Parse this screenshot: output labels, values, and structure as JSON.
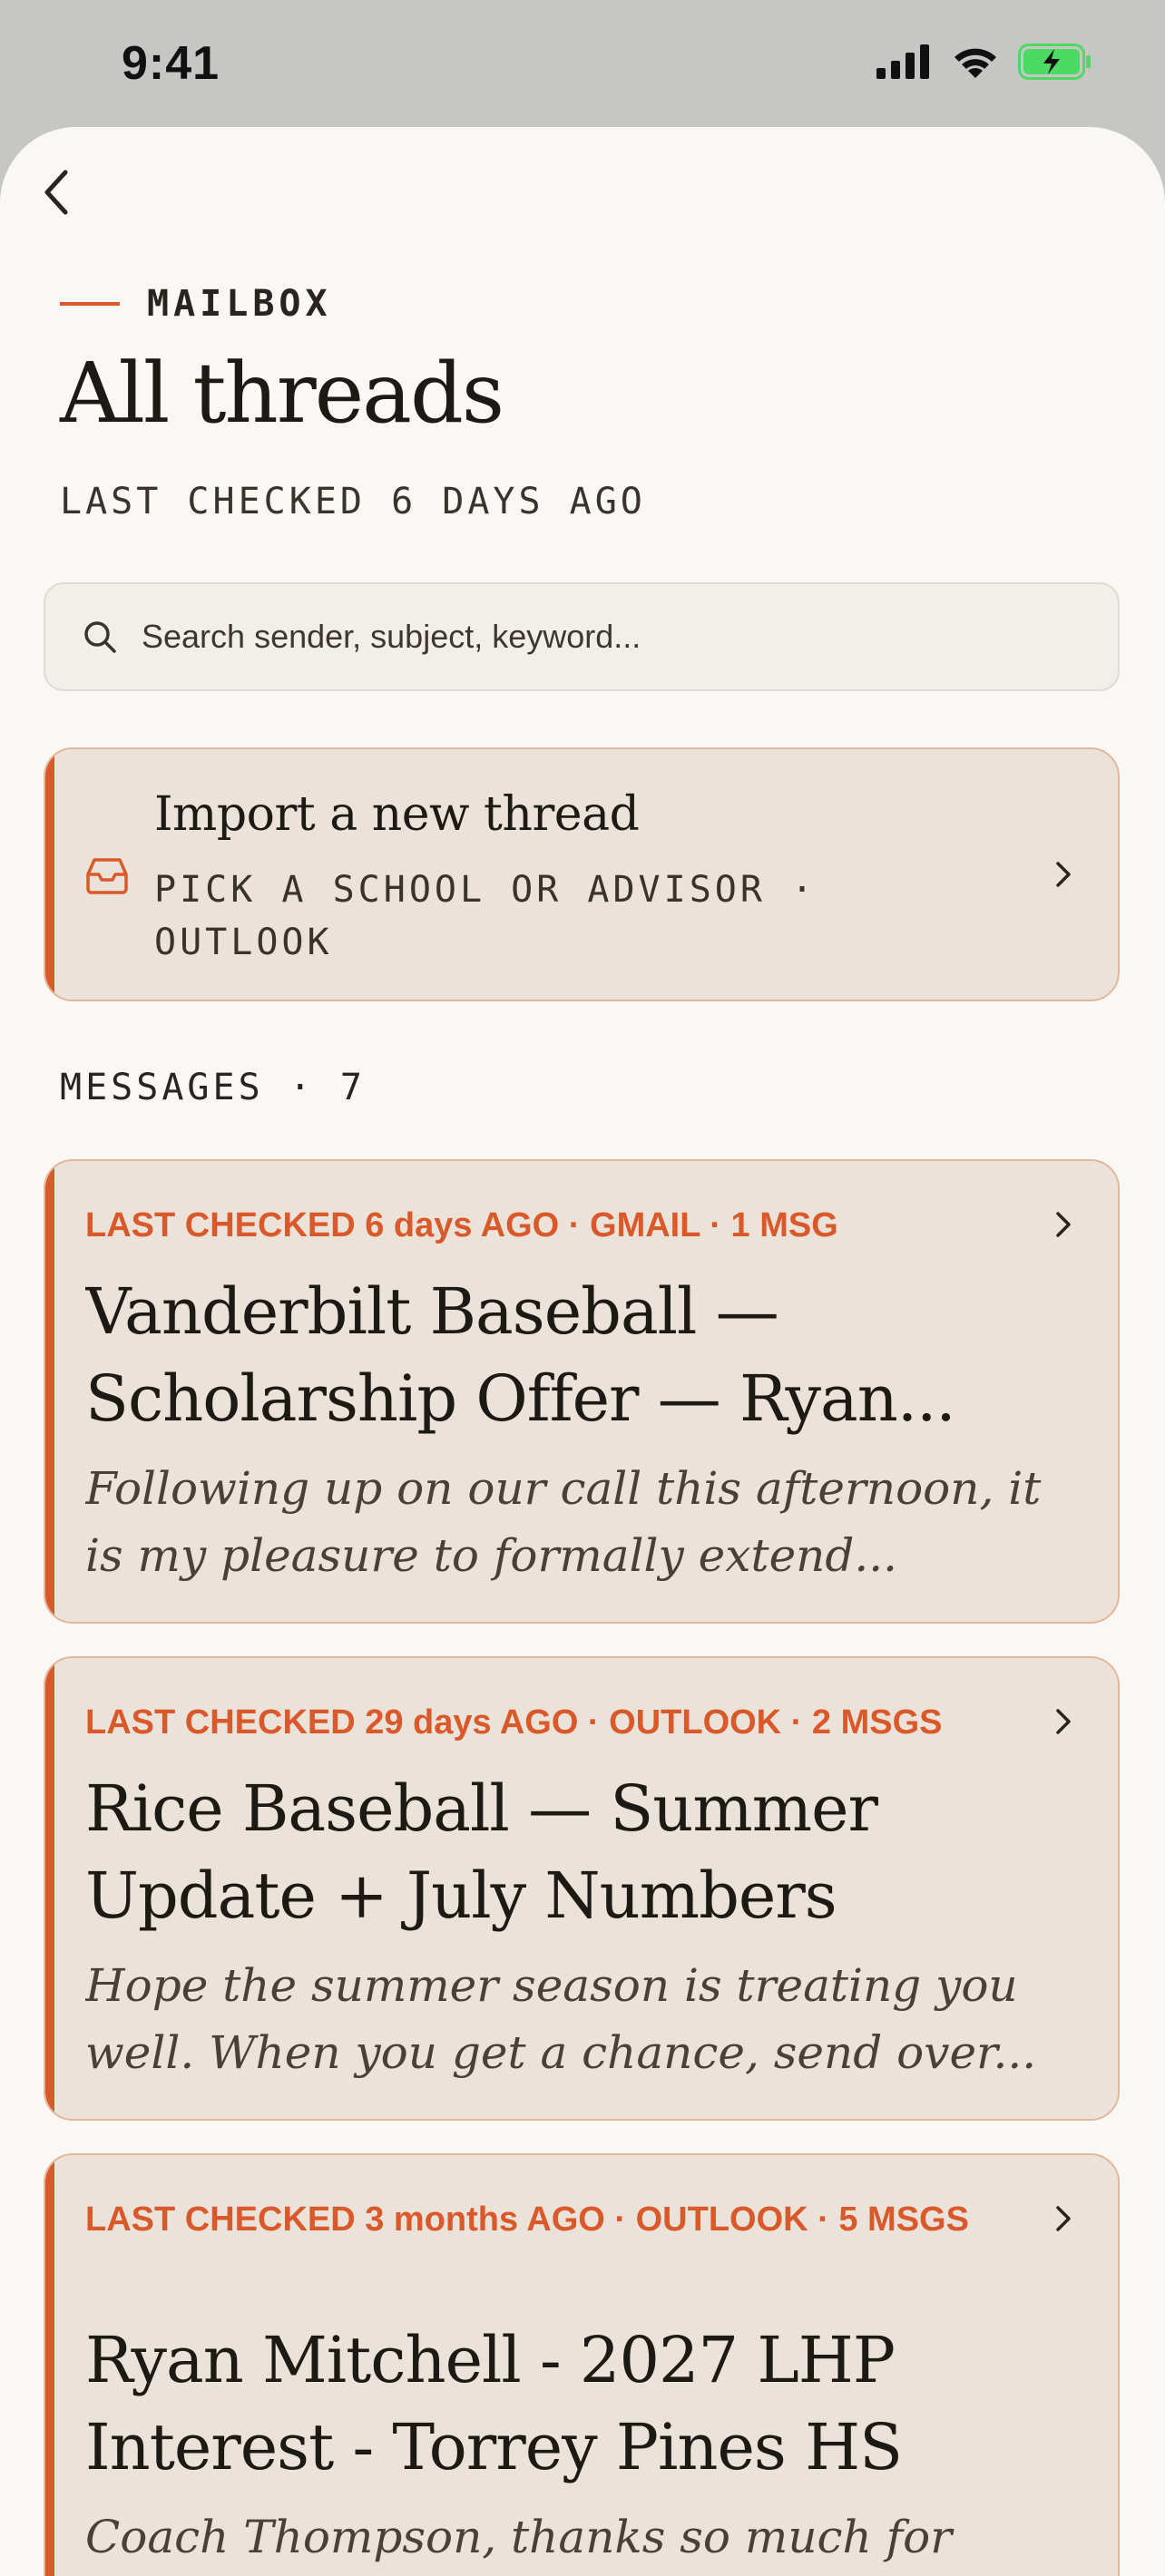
{
  "status": {
    "time": "9:41"
  },
  "header": {
    "eyebrow": "MAILBOX",
    "title": "All threads",
    "subtitle": "LAST CHECKED 6 DAYS AGO"
  },
  "search": {
    "placeholder": "Search sender, subject, keyword..."
  },
  "import": {
    "title": "Import a new thread",
    "subtitle": "PICK A SCHOOL OR ADVISOR · OUTLOOK"
  },
  "messages_section": {
    "label": "MESSAGES · 7"
  },
  "messages": [
    {
      "meta": "LAST CHECKED 6 days AGO · GMAIL · 1 MSG",
      "title": "Vanderbilt Baseball — Scholarship Offer — Ryan...",
      "preview": "Following up on our call this afternoon, it is my pleasure to formally extend..."
    },
    {
      "meta": "LAST CHECKED 29 days AGO · OUTLOOK · 2 MSGS",
      "title": "Rice Baseball — Summer Update + July Numbers",
      "preview": "Hope the summer season is treating you well. When you get a chance, send over..."
    },
    {
      "meta": "LAST CHECKED 3 months AGO · OUTLOOK · 5 MSGS",
      "title": "Ryan Mitchell - 2027 LHP Interest - Torrey Pines HS",
      "preview": "Coach Thompson, thanks so much for watching..."
    }
  ],
  "colors": {
    "accent": "#d9592b",
    "background": "#faf8f4",
    "card": "#ebe3d9",
    "card_border": "#e3b79b",
    "battery": "#4cd964"
  },
  "icons": {
    "back": "chevron-left-icon",
    "search": "search-icon",
    "import": "inbox-icon",
    "row": "chevron-right-icon"
  }
}
